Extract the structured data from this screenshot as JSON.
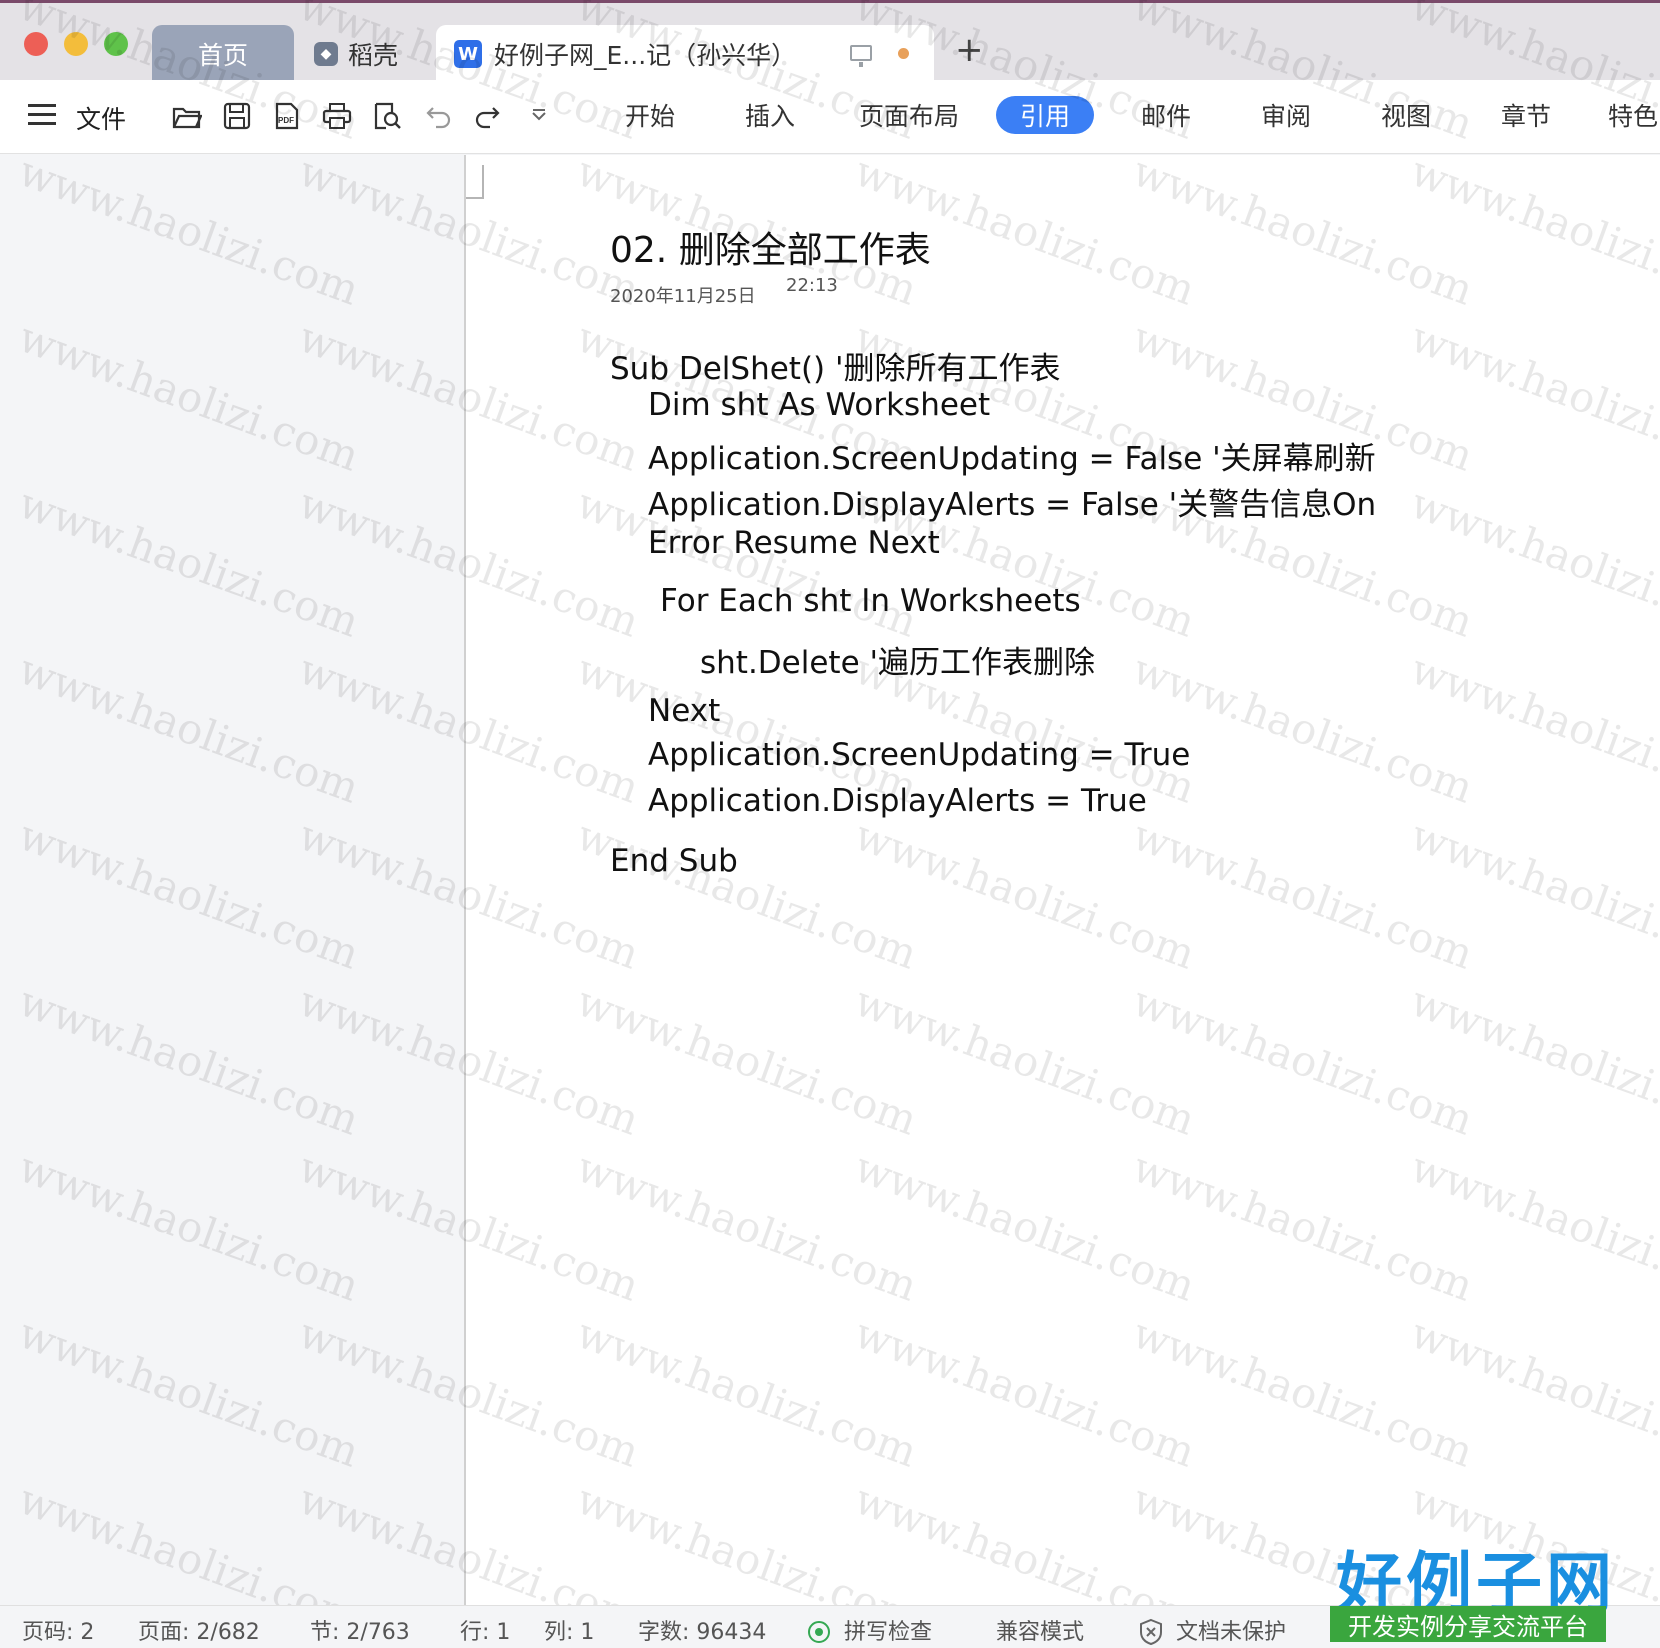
{
  "tabbar": {
    "home_tab": "首页",
    "daoke_tab": "稻壳",
    "doc_tab": "好例子网_E...记（孙兴华）",
    "new_tab": "+"
  },
  "toolbar": {
    "file_label": "文件",
    "icons": [
      "open-folder-icon",
      "save-icon",
      "export-pdf-icon",
      "print-icon",
      "print-preview-icon",
      "undo-icon",
      "redo-icon",
      "more-dropdown-icon"
    ],
    "tabs": [
      "开始",
      "插入",
      "页面布局",
      "引用",
      "邮件",
      "审阅",
      "视图",
      "章节",
      "特色"
    ],
    "active_tab": "引用",
    "accent_color": "#3b7ff5"
  },
  "document": {
    "heading": "02. 删除全部工作表",
    "date": "2020年11月25日",
    "time": "22:13",
    "code_lines": [
      "Sub DelShet() '删除所有工作表",
      "Dim sht As Worksheet",
      "Application.ScreenUpdating = False '关屏幕刷新",
      "Application.DisplayAlerts = False '关警告信息On",
      "Error Resume Next",
      "For Each sht In Worksheets",
      "sht.Delete '遍历工作表删除",
      "Next",
      "Application.ScreenUpdating = True",
      "Application.DisplayAlerts = True",
      "End Sub"
    ],
    "watermark": "www.haolizi.com"
  },
  "statusbar": {
    "page_code": "页码: 2",
    "page": "页面: 2/682",
    "section": "节: 2/763",
    "row": "行: 1",
    "col": "列: 1",
    "word_count": "字数: 96434",
    "spell_check": "拼写检查",
    "compat_mode": "兼容模式",
    "protection": "文档未保护"
  },
  "logo": {
    "main": "好例子网",
    "sub": "开发实例分享交流平台"
  }
}
